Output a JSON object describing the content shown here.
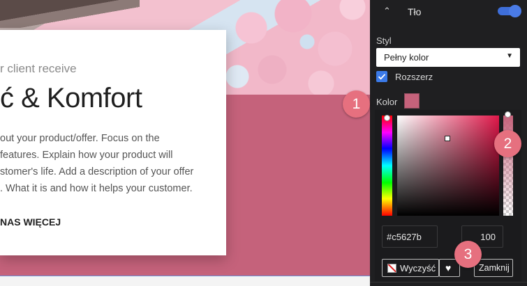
{
  "canvas": {
    "card": {
      "subtitle": "r client receive",
      "title": "ć & Komfort",
      "description_lines": [
        "out your product/offer. Focus on the",
        "features. Explain how your product will",
        "stomer's life. Add a description of your offer",
        ". What it is and how it helps your customer."
      ],
      "link_label": "NAS WIĘCEJ"
    },
    "section_color": "#c5627b"
  },
  "panel": {
    "section_title": "Tło",
    "toggle_on": true,
    "style_label": "Styl",
    "style_value": "Pełny kolor",
    "expand_label": "Rozszerz",
    "expand_checked": true,
    "color_label": "Kolor",
    "color_value": "#c5627b",
    "picker": {
      "hex_value": "#c5627b",
      "alpha_value": "100",
      "clear_label": "Wyczyść",
      "close_label": "Zamknij"
    }
  },
  "annotations": {
    "badge_1": "1",
    "badge_2": "2",
    "badge_3": "3"
  },
  "icons": [
    "chevron-up-icon",
    "caret-down-icon",
    "checkmark-icon",
    "no-color-icon",
    "heart-icon"
  ],
  "colors": {
    "accent": "#3b7ae8",
    "badge": "#e6707f",
    "panel_bg": "#1f1f21"
  }
}
